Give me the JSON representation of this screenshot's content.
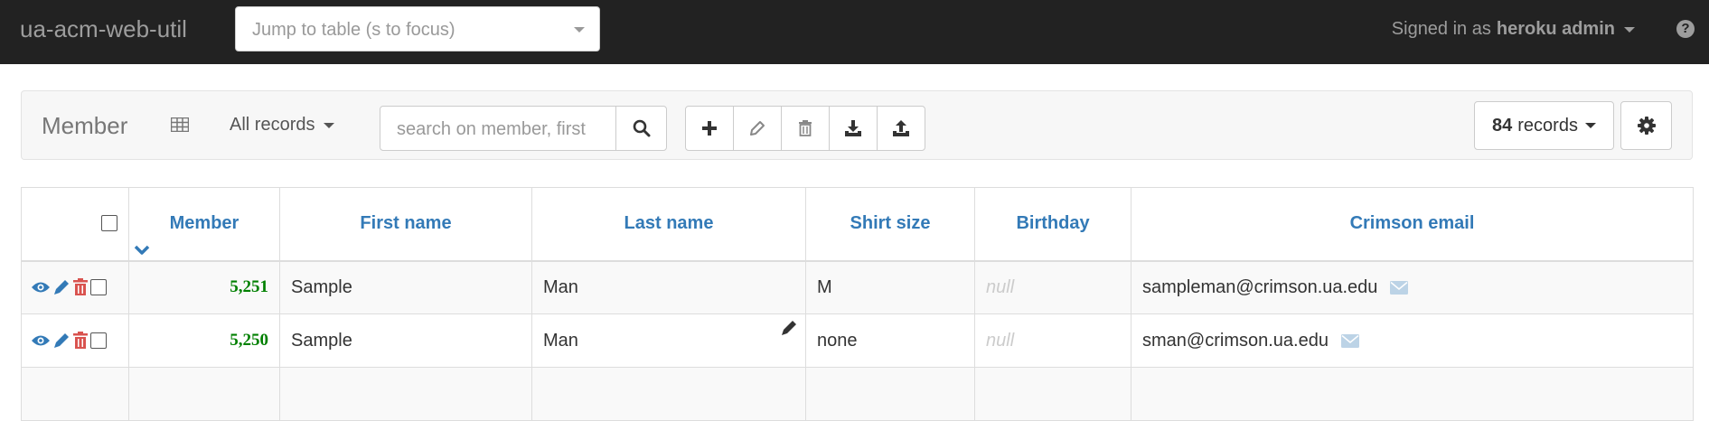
{
  "navbar": {
    "brand": "ua-acm-web-util",
    "jump_placeholder": "Jump to table (s to focus)",
    "signed_in_prefix": "Signed in as",
    "user": "heroku admin",
    "help_icon": "?"
  },
  "toolbar": {
    "title": "Member",
    "filter_label": "All records",
    "search_placeholder": "search on member, first",
    "records_count": "84",
    "records_label": "records"
  },
  "table": {
    "columns": [
      "Member",
      "First name",
      "Last name",
      "Shirt size",
      "Birthday",
      "Crimson email"
    ],
    "rows": [
      {
        "member": "5,251",
        "first": "Sample",
        "last": "Man",
        "shirt": "M",
        "birthday": "null",
        "email": "sampleman@crimson.ua.edu"
      },
      {
        "member": "5,250",
        "first": "Sample",
        "last": "Man",
        "shirt": "none",
        "birthday": "null",
        "email": "sman@crimson.ua.edu"
      }
    ]
  },
  "colors": {
    "navbar_bg": "#222222",
    "link_blue": "#337ab7",
    "number_green": "#008000",
    "delete_red": "#d9534f"
  }
}
